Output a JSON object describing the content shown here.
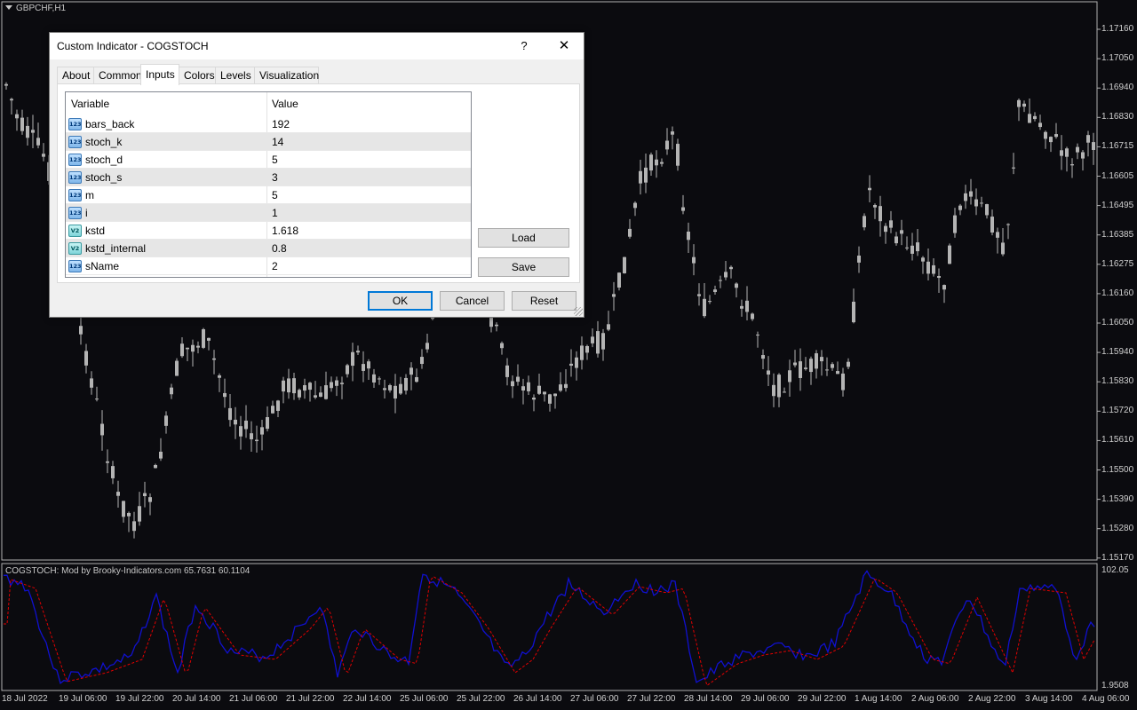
{
  "chart": {
    "symbol": "GBPCHF,H1",
    "indicator_label": "COGSTOCH: Mod by Brooky-Indicators.com 65.7631 60.1104",
    "price_axis": [
      "1.17160",
      "1.17050",
      "1.16940",
      "1.16830",
      "1.16715",
      "1.16605",
      "1.16495",
      "1.16385",
      "1.16275",
      "1.16160",
      "1.16050",
      "1.15940",
      "1.15830",
      "1.15720",
      "1.15610",
      "1.15500",
      "1.15390",
      "1.15280",
      "1.15170"
    ],
    "indicator_axis": [
      "102.05",
      "1.9508"
    ],
    "time_axis": [
      "18 Jul 2022",
      "19 Jul 06:00",
      "19 Jul 22:00",
      "20 Jul 14:00",
      "21 Jul 06:00",
      "21 Jul 22:00",
      "22 Jul 14:00",
      "25 Jul 06:00",
      "25 Jul 22:00",
      "26 Jul 14:00",
      "27 Jul 06:00",
      "27 Jul 22:00",
      "28 Jul 14:00",
      "29 Jul 06:00",
      "29 Jul 22:00",
      "1 Aug 14:00",
      "2 Aug 06:00",
      "2 Aug 22:00",
      "3 Aug 14:00",
      "4 Aug 06:00"
    ],
    "colors": {
      "background": "#0b0b0f",
      "candles": "#b4b4b4",
      "main_line": "#1010d0",
      "signal_line": "#e00000",
      "axis_text": "#d0d0d0"
    }
  },
  "dialog": {
    "title": "Custom Indicator - COGSTOCH",
    "help_label": "?",
    "close_label": "✕",
    "tabs": [
      {
        "label": "About",
        "active": false
      },
      {
        "label": "Common",
        "active": false
      },
      {
        "label": "Inputs",
        "active": true
      },
      {
        "label": "Colors",
        "active": false
      },
      {
        "label": "Levels",
        "active": false
      },
      {
        "label": "Visualization",
        "active": false
      }
    ],
    "table": {
      "headers": [
        "Variable",
        "Value"
      ],
      "rows": [
        {
          "icon": "int-icon",
          "icon_text": "123",
          "name": "bars_back",
          "value": "192"
        },
        {
          "icon": "int-icon",
          "icon_text": "123",
          "name": "stoch_k",
          "value": "14"
        },
        {
          "icon": "int-icon",
          "icon_text": "123",
          "name": "stoch_d",
          "value": "5"
        },
        {
          "icon": "int-icon",
          "icon_text": "123",
          "name": "stoch_s",
          "value": "3"
        },
        {
          "icon": "int-icon",
          "icon_text": "123",
          "name": "m",
          "value": "5"
        },
        {
          "icon": "int-icon",
          "icon_text": "123",
          "name": "i",
          "value": "1"
        },
        {
          "icon": "double-icon",
          "icon_text": "V2",
          "name": "kstd",
          "value": "1.618"
        },
        {
          "icon": "double-icon",
          "icon_text": "V2",
          "name": "kstd_internal",
          "value": "0.8"
        },
        {
          "icon": "int-icon",
          "icon_text": "123",
          "name": "sName",
          "value": "2"
        }
      ]
    },
    "side_buttons": {
      "load": "Load",
      "save": "Save"
    },
    "footer_buttons": {
      "ok": "OK",
      "cancel": "Cancel",
      "reset": "Reset"
    }
  }
}
